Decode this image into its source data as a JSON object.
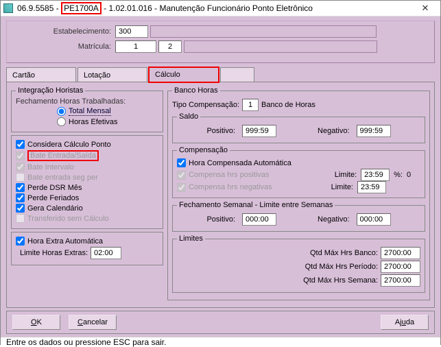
{
  "title": {
    "left": "06.9.5585 -",
    "code": "PE1700A",
    "right": "- 1.02.01.016 - Manutenção Funcionário Ponto Eletrônico"
  },
  "header": {
    "estab_label": "Estabelecimento:",
    "estab_value": "300",
    "matricula_label": "Matrícula:",
    "matricula_value": "1",
    "matricula_aux": "2"
  },
  "tabs": {
    "cartao": "Cartão",
    "lotacao": "Lotação",
    "calculo": "Cálculo"
  },
  "left": {
    "fs_integra": "Integração Horistas",
    "fechamento_label": "Fechamento Horas Trabalhadas:",
    "radio_total": "Total Mensal",
    "radio_efetivas": "Horas Efetivas",
    "chk_considera": "Considera Cálculo Ponto",
    "chk_bate_es": "Bate Entrada/Saída",
    "chk_bate_int": "Bate Intervalo",
    "chk_bate_seg": "Bate entrada seg per",
    "chk_perde_dsr": "Perde DSR Mês",
    "chk_perde_fer": "Perde Feriados",
    "chk_gera_cal": "Gera Calendário",
    "chk_transf": "Transferido sem Cálculo",
    "chk_hextra": "Hora Extra Automática",
    "limite_extra_label": "Limite Horas Extras:",
    "limite_extra_value": "02:00"
  },
  "right": {
    "fs_banco": "Banco Horas",
    "tipo_comp_label": "Tipo Compensação:",
    "tipo_comp_value": "1",
    "tipo_comp_desc": "Banco de Horas",
    "fs_saldo": "Saldo",
    "positivo_label": "Positivo:",
    "positivo_value": "999:59",
    "negativo_label": "Negativo:",
    "negativo_value": "999:59",
    "fs_comp": "Compensação",
    "chk_comp_auto": "Hora Compensada Automática",
    "chk_comp_pos": "Compensa hrs positivas",
    "chk_comp_neg": "Compensa hrs negativas",
    "limite_label": "Limite:",
    "limite_pos_value": "23:59",
    "pct_label": "%:",
    "pct_value": "0",
    "limite_neg_value": "23:59",
    "fs_fech": "Fechamento Semanal - Limite entre Semanas",
    "fech_pos_value": "000:00",
    "fech_neg_value": "000:00",
    "fs_lim": "Limites",
    "lim_banco_label": "Qtd Máx Hrs Banco:",
    "lim_banco_value": "2700:00",
    "lim_periodo_label": "Qtd Máx Hrs Período:",
    "lim_periodo_value": "2700:00",
    "lim_semana_label": "Qtd Máx Hrs Semana:",
    "lim_semana_value": "2700:00"
  },
  "buttons": {
    "ok": "OK",
    "cancelar": "Cancelar",
    "ajuda": "Ajuda"
  },
  "status": "Entre os dados ou pressione ESC para sair."
}
